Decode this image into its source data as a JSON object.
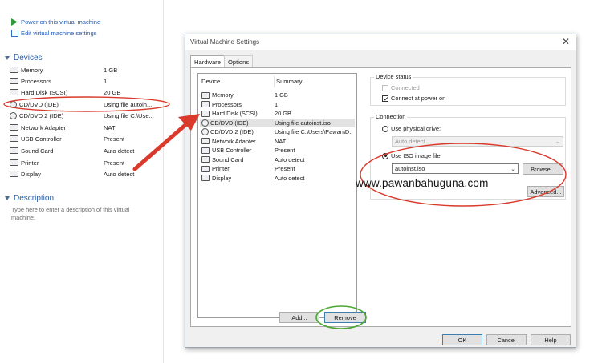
{
  "left_panel": {
    "commands": [
      {
        "label": "Power on this virtual machine",
        "icon": "play-icon"
      },
      {
        "label": "Edit virtual machine settings",
        "icon": "edit-icon"
      }
    ],
    "devices_heading": "Devices",
    "devices": [
      {
        "name": "Memory",
        "value": "1 GB",
        "icon": "memory-icon"
      },
      {
        "name": "Processors",
        "value": "1",
        "icon": "processor-icon"
      },
      {
        "name": "Hard Disk (SCSI)",
        "value": "20 GB",
        "icon": "hard-disk-icon"
      },
      {
        "name": "CD/DVD (IDE)",
        "value": "Using file autoin...",
        "icon": "cd-dvd-icon"
      },
      {
        "name": "CD/DVD 2 (IDE)",
        "value": "Using file C:\\Use...",
        "icon": "cd-dvd-icon"
      },
      {
        "name": "Network Adapter",
        "value": "NAT",
        "icon": "network-adapter-icon"
      },
      {
        "name": "USB Controller",
        "value": "Present",
        "icon": "usb-icon"
      },
      {
        "name": "Sound Card",
        "value": "Auto detect",
        "icon": "sound-card-icon"
      },
      {
        "name": "Printer",
        "value": "Present",
        "icon": "printer-icon"
      },
      {
        "name": "Display",
        "value": "Auto detect",
        "icon": "display-icon"
      }
    ],
    "description_heading": "Description",
    "description_placeholder": "Type here to enter a description of this virtual machine."
  },
  "dialog": {
    "title": "Virtual Machine Settings",
    "close_glyph": "✕",
    "tabs": [
      "Hardware",
      "Options"
    ],
    "list_headers": {
      "device": "Device",
      "summary": "Summary"
    },
    "devices": [
      {
        "name": "Memory",
        "summary": "1 GB"
      },
      {
        "name": "Processors",
        "summary": "1"
      },
      {
        "name": "Hard Disk (SCSI)",
        "summary": "20 GB"
      },
      {
        "name": "CD/DVD (IDE)",
        "summary": "Using file autoinst.iso"
      },
      {
        "name": "CD/DVD 2 (IDE)",
        "summary": "Using file C:\\Users\\Pawan\\D..."
      },
      {
        "name": "Network Adapter",
        "summary": "NAT"
      },
      {
        "name": "USB Controller",
        "summary": "Present"
      },
      {
        "name": "Sound Card",
        "summary": "Auto detect"
      },
      {
        "name": "Printer",
        "summary": "Present"
      },
      {
        "name": "Display",
        "summary": "Auto detect"
      }
    ],
    "selected_device": "CD/DVD (IDE)",
    "add_button": "Add...",
    "remove_button": "Remove",
    "device_status": {
      "legend": "Device status",
      "connected": "Connected",
      "connect_at_power_on": "Connect at power on"
    },
    "connection": {
      "legend": "Connection",
      "use_physical": "Use physical drive:",
      "physical_value": "Auto detect",
      "use_iso": "Use ISO image file:",
      "iso_value": "autoinst.iso",
      "browse": "Browse...",
      "advanced": "Advanced..."
    },
    "footer": {
      "ok": "OK",
      "cancel": "Cancel",
      "help": "Help"
    }
  },
  "watermark": "www.pawanbahuguna.com",
  "colors": {
    "link_blue": "#1f58b8",
    "annotation_red": "#d93a2b",
    "annotation_green": "#4aa832",
    "dialog_bg": "#f0f0f0"
  }
}
